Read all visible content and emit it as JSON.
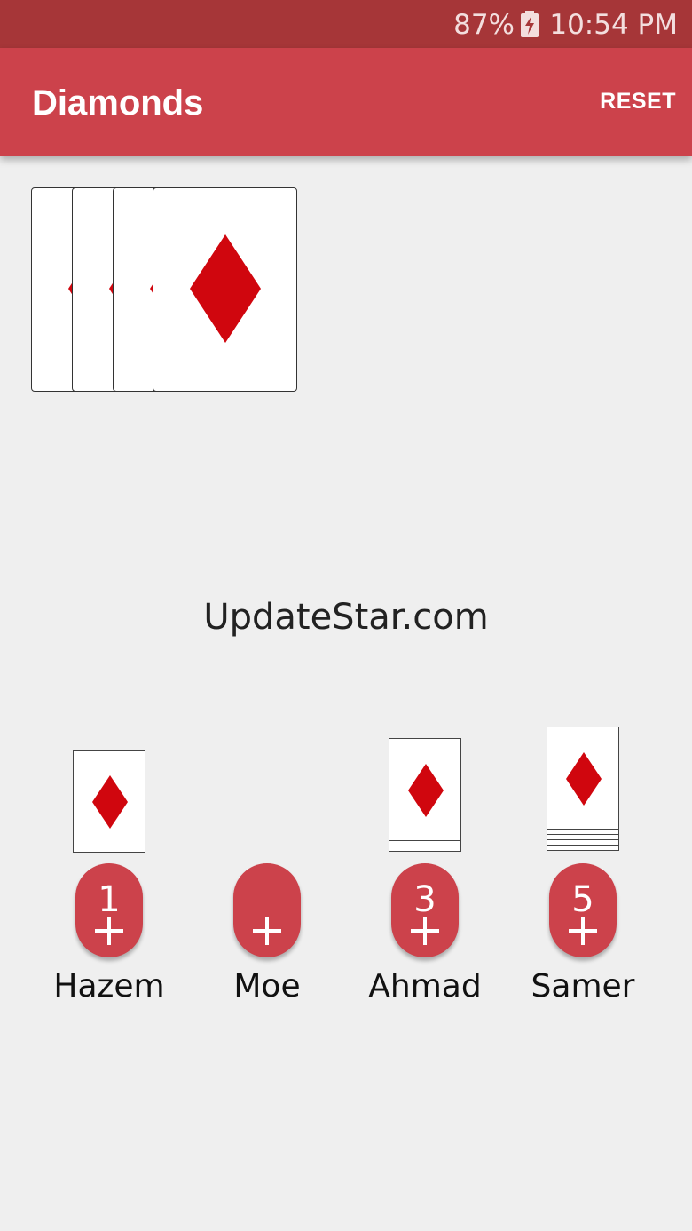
{
  "status_bar": {
    "battery": "87%",
    "time": "10:54 PM",
    "battery_icon": "battery-charging-icon"
  },
  "app_bar": {
    "title": "Diamonds",
    "reset_label": "RESET"
  },
  "watermark": "UpdateStar.com",
  "colors": {
    "accent": "#cc424b",
    "status_bar": "#a63638",
    "diamond": "#d0060e",
    "background": "#efefef"
  },
  "players": [
    {
      "name": "Hazem",
      "score": "1",
      "stack_lines": 0
    },
    {
      "name": "Moe",
      "score": "",
      "stack_lines": null
    },
    {
      "name": "Ahmad",
      "score": "3",
      "stack_lines": 2
    },
    {
      "name": "Samer",
      "score": "5",
      "stack_lines": 4
    }
  ]
}
